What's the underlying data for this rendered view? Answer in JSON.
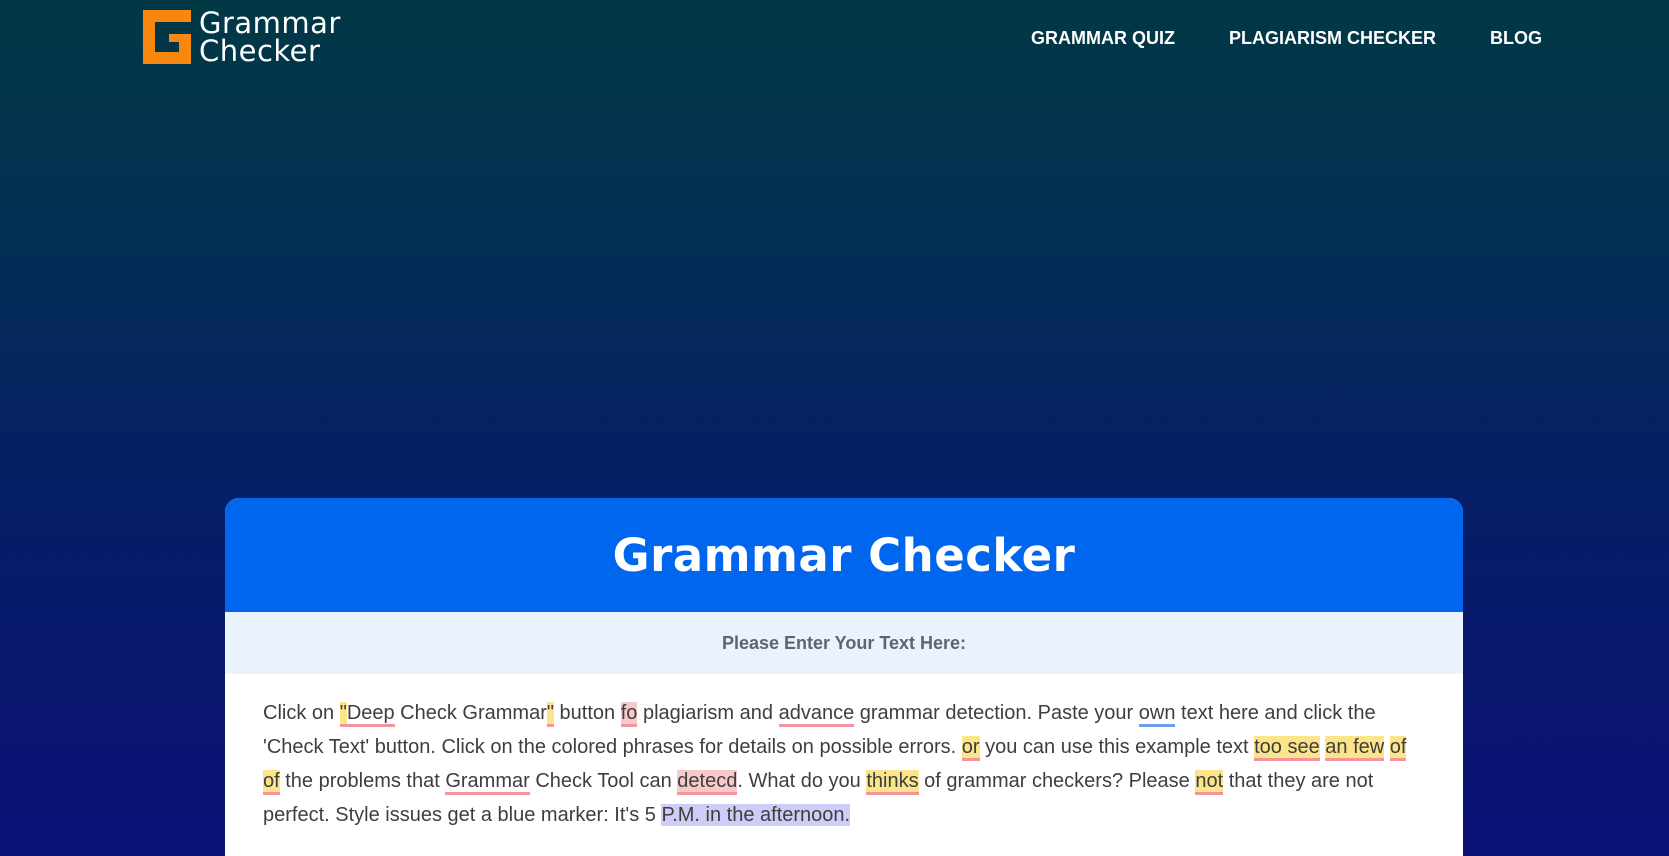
{
  "header": {
    "logo_line1": "Grammar",
    "logo_line2": "Checker",
    "brand_color": "#f7870f",
    "nav": [
      {
        "label": "GRAMMAR QUIZ"
      },
      {
        "label": "PLAGIARISM CHECKER"
      },
      {
        "label": "BLOG"
      }
    ]
  },
  "card": {
    "title": "Grammar Checker",
    "subtitle": "Please Enter Your Text Here:",
    "accent_color": "#0166ee"
  },
  "editor": {
    "segments": {
      "s1": "Click on ",
      "q1": "\"",
      "h1": "Deep",
      "s2": " Check Grammar",
      "q2": "\"",
      "s3": " button ",
      "h2": "fo",
      "s4": " plagiarism and ",
      "h3": "advance",
      "s5": " grammar detection. Paste your ",
      "h4": "own",
      "s6": " text here and click the 'Check Text' button. Click on the colored phrases for details on possible errors. ",
      "h5": "or",
      "s7": " you can use this example text ",
      "h6": "too see",
      "s8": " ",
      "h7": "an few",
      "s9": " ",
      "h8": "of of",
      "s10": " the problems that ",
      "h9": "Grammar",
      "s11": " Check Tool can ",
      "h10": "detecd",
      "s12": ". What do you ",
      "h11": "thinks",
      "s13": " of grammar checkers? Please ",
      "h12": "not",
      "s14": " that they are not perfect. Style issues get a blue marker: It's 5 ",
      "h13": "P.M. in the afternoon."
    }
  }
}
